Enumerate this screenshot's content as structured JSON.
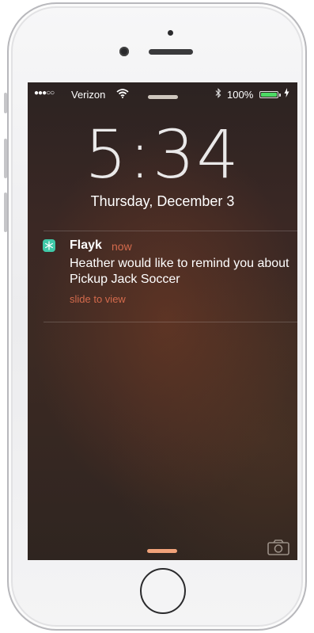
{
  "status_bar": {
    "signal": "●●●○○",
    "carrier": "Verizon",
    "wifi_icon": "wifi-icon",
    "bluetooth_icon": "bluetooth-icon",
    "battery_percent": "100%",
    "battery_level": 1.0,
    "battery_color": "#4cd964",
    "charging_icon": "lightning-bolt-icon"
  },
  "lock_screen": {
    "time": "5:34",
    "date": "Thursday, December 3"
  },
  "notification": {
    "app_icon": "snowflake-icon",
    "app_icon_color": "#3fc9a8",
    "app_name": "Flayk",
    "time_label": "now",
    "message": "Heather would like to remind you about Pickup Jack Soccer",
    "action": "slide to view",
    "accent_color": "#d36a4c"
  },
  "bottom": {
    "camera_icon": "camera-icon"
  }
}
